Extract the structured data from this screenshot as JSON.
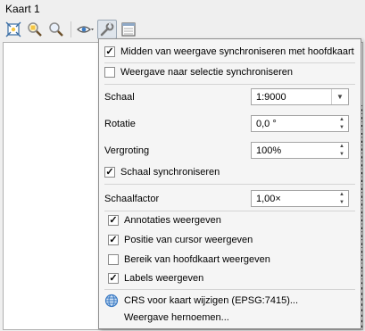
{
  "window": {
    "title": "Kaart 1"
  },
  "toolbar": {
    "icons": [
      "zoom-full-icon",
      "zoom-layer-icon",
      "zoom-selection-icon",
      "view-eye-icon",
      "settings-wrench-icon",
      "map-canvas-icon"
    ]
  },
  "menu": {
    "sync_center": {
      "label": "Midden van weergave synchroniseren met hoofdkaart",
      "checked": true
    },
    "sync_selection": {
      "label": "Weergave naar selectie synchroniseren",
      "checked": false
    },
    "scale": {
      "label": "Schaal",
      "value": "1:9000"
    },
    "rotation": {
      "label": "Rotatie",
      "value": "0,0 °"
    },
    "magnification": {
      "label": "Vergroting",
      "value": "100%"
    },
    "sync_scale": {
      "label": "Schaal synchroniseren",
      "checked": true
    },
    "scale_factor": {
      "label": "Schaalfactor",
      "value": "1,00×"
    },
    "show_annotations": {
      "label": "Annotaties weergeven",
      "checked": true
    },
    "show_cursor": {
      "label": "Positie van cursor weergeven",
      "checked": true
    },
    "show_main_extent": {
      "label": "Bereik van hoofdkaart weergeven",
      "checked": false
    },
    "show_labels": {
      "label": "Labels weergeven",
      "checked": true
    },
    "change_crs": {
      "label": "CRS voor kaart wijzigen (EPSG:7415)..."
    },
    "rename_view": {
      "label": "Weergave hernoemen..."
    }
  },
  "colors": {
    "menu_bg": "#f5f5f5",
    "active_button": "#dfe5ec",
    "globe_blue": "#3b7bc4"
  }
}
